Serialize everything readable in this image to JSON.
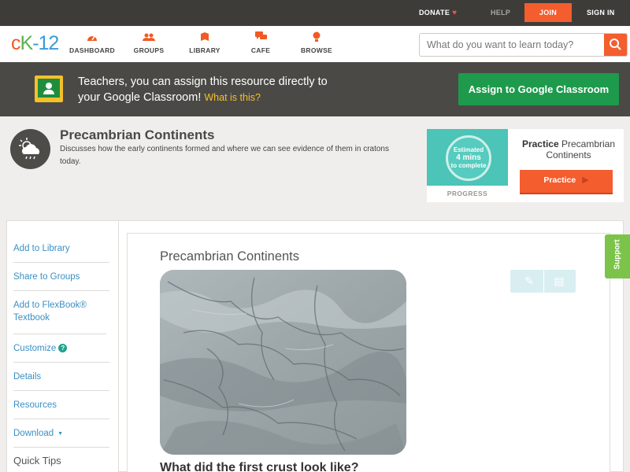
{
  "topbar": {
    "donate": "DONATE",
    "help": "HELP",
    "join": "JOIN",
    "signin": "SIGN IN"
  },
  "logo": {
    "c": "c",
    "k": "K",
    "n": "-12"
  },
  "nav": [
    {
      "label": "DASHBOARD",
      "icon": "dashboard-icon"
    },
    {
      "label": "GROUPS",
      "icon": "groups-icon"
    },
    {
      "label": "LIBRARY",
      "icon": "library-icon"
    },
    {
      "label": "CAFE",
      "icon": "cafe-icon"
    },
    {
      "label": "BROWSE",
      "icon": "browse-icon"
    }
  ],
  "search": {
    "placeholder": "What do you want to learn today?"
  },
  "classroom_banner": {
    "line1": "Teachers, you can assign this resource directly to",
    "line2": "your Google Classroom!",
    "what_link": "What is this?",
    "button": "Assign to Google Classroom"
  },
  "concept": {
    "title": "Precambrian Continents",
    "description": "Discusses how the early continents formed and where we can see evidence of them in cratons today."
  },
  "practice": {
    "estimated_l1": "Estimated",
    "estimated_l2": "4 mins",
    "estimated_l3": "to complete",
    "progress_label": "PROGRESS",
    "title_bold": "Practice",
    "title_rest": "Precambrian Continents",
    "button": "Practice"
  },
  "sidebar": {
    "items": [
      "Add to Library",
      "Share to Groups",
      "Add to FlexBook® Textbook",
      "Customize",
      "Details",
      "Resources",
      "Download"
    ],
    "quick_tips": "Quick Tips"
  },
  "main": {
    "title": "Precambrian Continents",
    "subheading": "What did the first crust look like?"
  },
  "support": "Support",
  "colors": {
    "brand_orange": "#f45d2e",
    "classroom_green": "#1e9a4c",
    "link_blue": "#3b8fc4",
    "support_green": "#7cc34a"
  }
}
